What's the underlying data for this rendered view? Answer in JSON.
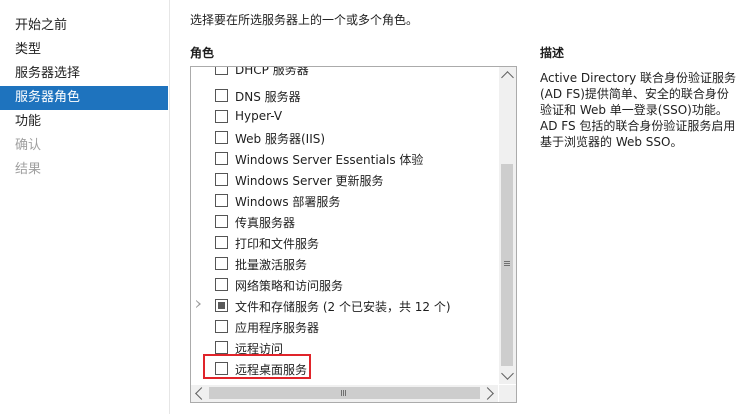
{
  "nav": {
    "items": [
      {
        "label": "开始之前",
        "state": "normal"
      },
      {
        "label": "类型",
        "state": "normal"
      },
      {
        "label": "服务器选择",
        "state": "normal"
      },
      {
        "label": "服务器角色",
        "state": "active"
      },
      {
        "label": "功能",
        "state": "normal"
      },
      {
        "label": "确认",
        "state": "disabled"
      },
      {
        "label": "结果",
        "state": "disabled"
      }
    ]
  },
  "instruction": "选择要在所选服务器上的一个或多个角色。",
  "roles": {
    "title": "角色",
    "items": [
      {
        "label": "DHCP 服务器",
        "checked": false
      },
      {
        "label": "DNS 服务器",
        "checked": false
      },
      {
        "label": "Hyper-V",
        "checked": false
      },
      {
        "label": "Web 服务器(IIS)",
        "checked": false
      },
      {
        "label": "Windows Server Essentials 体验",
        "checked": false
      },
      {
        "label": "Windows Server 更新服务",
        "checked": false
      },
      {
        "label": "Windows 部署服务",
        "checked": false
      },
      {
        "label": "传真服务器",
        "checked": false
      },
      {
        "label": "打印和文件服务",
        "checked": false
      },
      {
        "label": "批量激活服务",
        "checked": false
      },
      {
        "label": "网络策略和访问服务",
        "checked": false
      },
      {
        "label": "文件和存储服务 (2 个已安装，共 12 个)",
        "checked": "partial",
        "expandable": true
      },
      {
        "label": "应用程序服务器",
        "checked": false
      },
      {
        "label": "远程访问",
        "checked": false
      },
      {
        "label": "远程桌面服务",
        "checked": false,
        "highlighted": true
      }
    ]
  },
  "description": {
    "title": "描述",
    "text": "Active Directory 联合身份验证服务(AD FS)提供简单、安全的联合身份验证和 Web 单一登录(SSO)功能。AD FS 包括的联合身份验证服务启用基于浏览器的 Web SSO。"
  },
  "colors": {
    "nav_active_bg": "#1e73be",
    "highlight_border": "#e0242a"
  },
  "icons": {
    "scroll_up": "chevron-up-icon",
    "scroll_down": "chevron-down-icon",
    "scroll_left": "chevron-left-icon",
    "scroll_right": "chevron-right-icon",
    "expander": "triangle-right-icon"
  }
}
